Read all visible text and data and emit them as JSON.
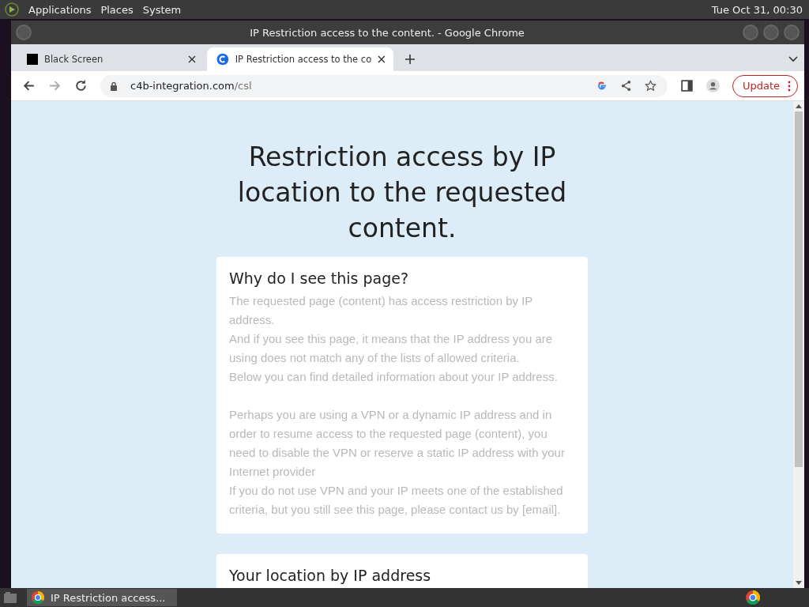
{
  "top_panel": {
    "menus": [
      "Applications",
      "Places",
      "System"
    ],
    "clock": "Tue Oct 31, 00:30"
  },
  "window": {
    "title": "IP Restriction access to the content. - Google Chrome"
  },
  "tabs": [
    {
      "label": "Black Screen",
      "selected": false,
      "kind": "black"
    },
    {
      "label": "IP Restriction access to the co",
      "selected": true,
      "kind": "site"
    }
  ],
  "address_bar": {
    "domain": "c4b-integration.com",
    "path": "/csl"
  },
  "update_button": "Update",
  "page": {
    "heading": "Restriction access by IP location to the requested content.",
    "cards": [
      {
        "title": "Why do I see this page?",
        "paragraphs": [
          [
            "The requested page (content) has access restriction by IP address.",
            "And if you see this page, it means that the IP address you are using does not match any of the lists of allowed criteria.",
            "Below you can find detailed information about your IP address."
          ],
          [
            "Perhaps you are using a VPN or a dynamic IP address and in order to resume access to the requested page (content), you need to disable the VPN or reserve a static IP address with your Internet provider",
            "If you do not use VPN and your IP meets one of the established criteria, but you still see this page, please contact us by [email]."
          ]
        ]
      },
      {
        "title": "Your location by IP address"
      }
    ]
  },
  "taskbar": {
    "items": [
      {
        "label": "IP Restriction access...",
        "selected": true
      }
    ]
  }
}
